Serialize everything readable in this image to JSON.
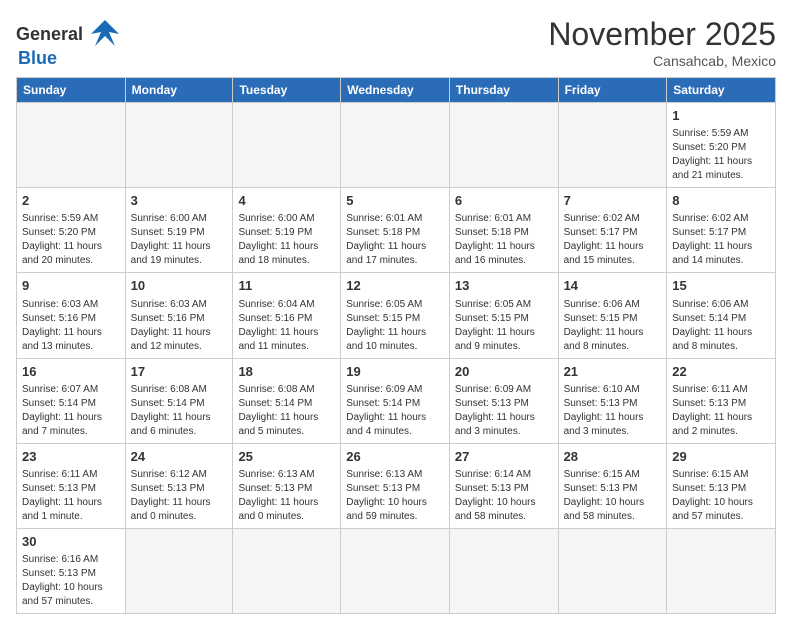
{
  "header": {
    "logo_line1": "General",
    "logo_line2": "Blue",
    "month_title": "November 2025",
    "location": "Cansahcab, Mexico"
  },
  "weekdays": [
    "Sunday",
    "Monday",
    "Tuesday",
    "Wednesday",
    "Thursday",
    "Friday",
    "Saturday"
  ],
  "weeks": [
    [
      {
        "day": "",
        "info": ""
      },
      {
        "day": "",
        "info": ""
      },
      {
        "day": "",
        "info": ""
      },
      {
        "day": "",
        "info": ""
      },
      {
        "day": "",
        "info": ""
      },
      {
        "day": "",
        "info": ""
      },
      {
        "day": "1",
        "info": "Sunrise: 5:59 AM\nSunset: 5:20 PM\nDaylight: 11 hours\nand 21 minutes."
      }
    ],
    [
      {
        "day": "2",
        "info": "Sunrise: 5:59 AM\nSunset: 5:20 PM\nDaylight: 11 hours\nand 20 minutes."
      },
      {
        "day": "3",
        "info": "Sunrise: 6:00 AM\nSunset: 5:19 PM\nDaylight: 11 hours\nand 19 minutes."
      },
      {
        "day": "4",
        "info": "Sunrise: 6:00 AM\nSunset: 5:19 PM\nDaylight: 11 hours\nand 18 minutes."
      },
      {
        "day": "5",
        "info": "Sunrise: 6:01 AM\nSunset: 5:18 PM\nDaylight: 11 hours\nand 17 minutes."
      },
      {
        "day": "6",
        "info": "Sunrise: 6:01 AM\nSunset: 5:18 PM\nDaylight: 11 hours\nand 16 minutes."
      },
      {
        "day": "7",
        "info": "Sunrise: 6:02 AM\nSunset: 5:17 PM\nDaylight: 11 hours\nand 15 minutes."
      },
      {
        "day": "8",
        "info": "Sunrise: 6:02 AM\nSunset: 5:17 PM\nDaylight: 11 hours\nand 14 minutes."
      }
    ],
    [
      {
        "day": "9",
        "info": "Sunrise: 6:03 AM\nSunset: 5:16 PM\nDaylight: 11 hours\nand 13 minutes."
      },
      {
        "day": "10",
        "info": "Sunrise: 6:03 AM\nSunset: 5:16 PM\nDaylight: 11 hours\nand 12 minutes."
      },
      {
        "day": "11",
        "info": "Sunrise: 6:04 AM\nSunset: 5:16 PM\nDaylight: 11 hours\nand 11 minutes."
      },
      {
        "day": "12",
        "info": "Sunrise: 6:05 AM\nSunset: 5:15 PM\nDaylight: 11 hours\nand 10 minutes."
      },
      {
        "day": "13",
        "info": "Sunrise: 6:05 AM\nSunset: 5:15 PM\nDaylight: 11 hours\nand 9 minutes."
      },
      {
        "day": "14",
        "info": "Sunrise: 6:06 AM\nSunset: 5:15 PM\nDaylight: 11 hours\nand 8 minutes."
      },
      {
        "day": "15",
        "info": "Sunrise: 6:06 AM\nSunset: 5:14 PM\nDaylight: 11 hours\nand 8 minutes."
      }
    ],
    [
      {
        "day": "16",
        "info": "Sunrise: 6:07 AM\nSunset: 5:14 PM\nDaylight: 11 hours\nand 7 minutes."
      },
      {
        "day": "17",
        "info": "Sunrise: 6:08 AM\nSunset: 5:14 PM\nDaylight: 11 hours\nand 6 minutes."
      },
      {
        "day": "18",
        "info": "Sunrise: 6:08 AM\nSunset: 5:14 PM\nDaylight: 11 hours\nand 5 minutes."
      },
      {
        "day": "19",
        "info": "Sunrise: 6:09 AM\nSunset: 5:14 PM\nDaylight: 11 hours\nand 4 minutes."
      },
      {
        "day": "20",
        "info": "Sunrise: 6:09 AM\nSunset: 5:13 PM\nDaylight: 11 hours\nand 3 minutes."
      },
      {
        "day": "21",
        "info": "Sunrise: 6:10 AM\nSunset: 5:13 PM\nDaylight: 11 hours\nand 3 minutes."
      },
      {
        "day": "22",
        "info": "Sunrise: 6:11 AM\nSunset: 5:13 PM\nDaylight: 11 hours\nand 2 minutes."
      }
    ],
    [
      {
        "day": "23",
        "info": "Sunrise: 6:11 AM\nSunset: 5:13 PM\nDaylight: 11 hours\nand 1 minute."
      },
      {
        "day": "24",
        "info": "Sunrise: 6:12 AM\nSunset: 5:13 PM\nDaylight: 11 hours\nand 0 minutes."
      },
      {
        "day": "25",
        "info": "Sunrise: 6:13 AM\nSunset: 5:13 PM\nDaylight: 11 hours\nand 0 minutes."
      },
      {
        "day": "26",
        "info": "Sunrise: 6:13 AM\nSunset: 5:13 PM\nDaylight: 10 hours\nand 59 minutes."
      },
      {
        "day": "27",
        "info": "Sunrise: 6:14 AM\nSunset: 5:13 PM\nDaylight: 10 hours\nand 58 minutes."
      },
      {
        "day": "28",
        "info": "Sunrise: 6:15 AM\nSunset: 5:13 PM\nDaylight: 10 hours\nand 58 minutes."
      },
      {
        "day": "29",
        "info": "Sunrise: 6:15 AM\nSunset: 5:13 PM\nDaylight: 10 hours\nand 57 minutes."
      }
    ],
    [
      {
        "day": "30",
        "info": "Sunrise: 6:16 AM\nSunset: 5:13 PM\nDaylight: 10 hours\nand 57 minutes."
      },
      {
        "day": "",
        "info": ""
      },
      {
        "day": "",
        "info": ""
      },
      {
        "day": "",
        "info": ""
      },
      {
        "day": "",
        "info": ""
      },
      {
        "day": "",
        "info": ""
      },
      {
        "day": "",
        "info": ""
      }
    ]
  ]
}
